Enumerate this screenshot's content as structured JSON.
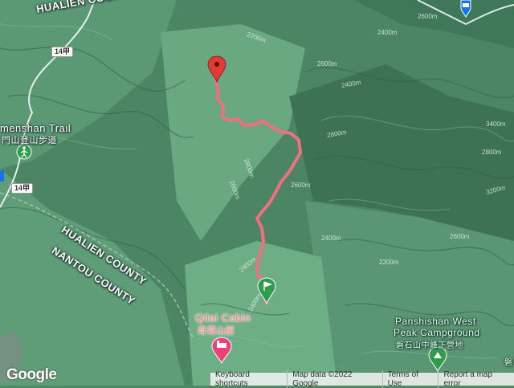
{
  "labels": {
    "hualien_county_top": "HUALIEN COUNTY",
    "hualien_county_mid": "HUALIEN COUNTY",
    "nantou_county": "NANTOU COUNTY",
    "trail_name": "menshan Trail",
    "trail_name_zh": "門山登山步道",
    "qilai_cabin": "Qilai Cabin",
    "qilai_cabin_zh": "奇萊山屋",
    "camp_line1": "Panshishan West",
    "camp_line2": "Peak Campground",
    "camp_zh": "磐石山中峰下營地",
    "edge_zh": "磐"
  },
  "shields": {
    "route_a": "14甲",
    "route_b": "14甲"
  },
  "contours": [
    "2200m",
    "2400m",
    "2600m",
    "2800m",
    "2600m",
    "2800m",
    "3200m",
    "2400m",
    "2200m",
    "2400m",
    "2800m",
    "2600m",
    "2400m",
    "2600m",
    "3400m",
    "2600m",
    "2400m"
  ],
  "footer": {
    "keyboard": "Keyboard shortcuts",
    "mapdata": "Map data ©2022 Google",
    "terms": "Terms of Use",
    "report": "Report a map error"
  },
  "logo": "Google",
  "colors": {
    "track": "#f07080",
    "start_marker": "#2e9e4c",
    "end_marker": "#e53935",
    "camp_icon": "#2e9e4c",
    "hotel_icon": "#ec407a"
  }
}
